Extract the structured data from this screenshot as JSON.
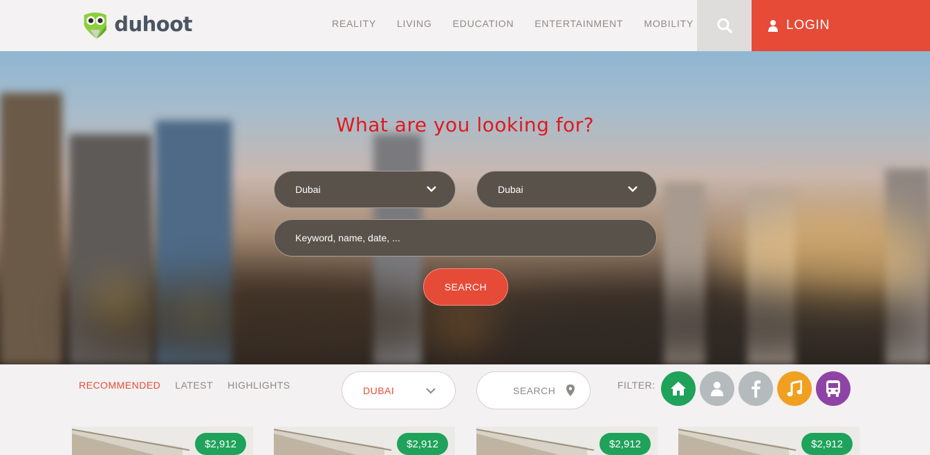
{
  "brand": {
    "name": "duhoot"
  },
  "nav": {
    "items": [
      "REALITY",
      "LIVING",
      "EDUCATION",
      "ENTERTAINMENT",
      "MOBILITY"
    ],
    "login_label": "LOGIN"
  },
  "hero": {
    "title": "What are you looking for?",
    "select_one": "Dubai",
    "select_two": "Dubai",
    "keyword_placeholder": "Keyword, name, date, ...",
    "search_button": "SEARCH"
  },
  "toolbar": {
    "tabs": [
      "RECOMMENDED",
      "LATEST",
      "HIGHLIGHTS"
    ],
    "active_tab": "RECOMMENDED",
    "city_select": "DUBAI",
    "search_label": "SEARCH",
    "filter_label": "FILTER:"
  },
  "filters": [
    {
      "icon": "home-icon",
      "color": "#1fa25a"
    },
    {
      "icon": "user-icon",
      "color": "#b5bbbc"
    },
    {
      "icon": "facebook-icon",
      "color": "#b5bbbc"
    },
    {
      "icon": "music-icon",
      "color": "#f0a020"
    },
    {
      "icon": "bus-icon",
      "color": "#8e44a4"
    }
  ],
  "cards": [
    {
      "price": "$2,912"
    },
    {
      "price": "$2,912"
    },
    {
      "price": "$2,912"
    },
    {
      "price": "$2,912"
    }
  ],
  "colors": {
    "accent": "#e64b37",
    "title_red": "#e0191e",
    "price_green": "#1fa25a"
  }
}
